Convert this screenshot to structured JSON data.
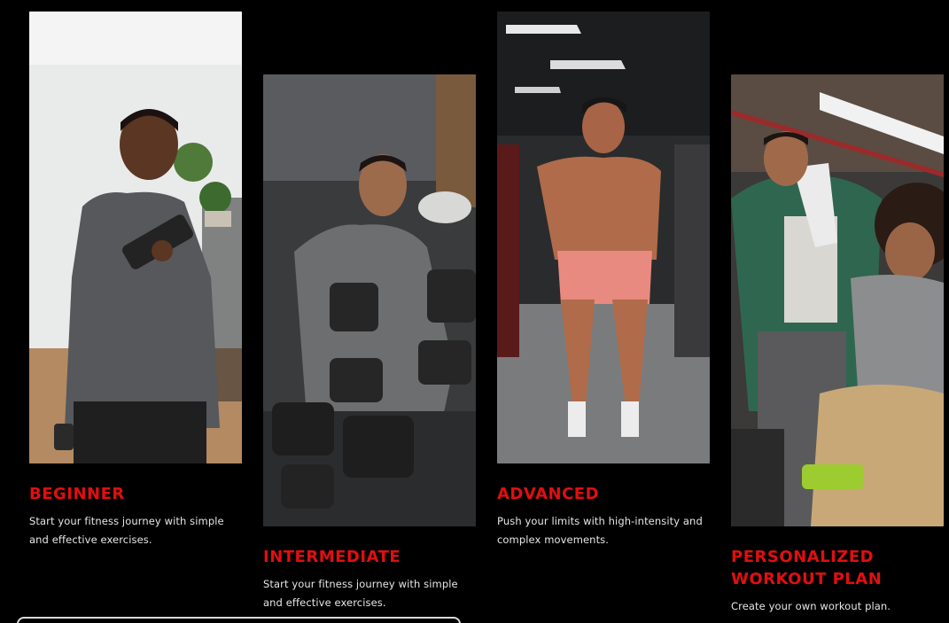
{
  "levels": [
    {
      "title": "BEGINNER",
      "description": "Start your fitness journey with simple and effective exercises."
    },
    {
      "title": "INTERMEDIATE",
      "description": "Start your fitness journey with simple and effective exercises."
    },
    {
      "title": "ADVANCED",
      "description": "Push your limits with high-intensity and complex movements."
    },
    {
      "title": "PERSONALIZED WORKOUT PLAN",
      "description": "Create your own workout plan."
    }
  ],
  "colors": {
    "background": "#000000",
    "accent": "#e10f0f",
    "text": "#e6e6e6"
  }
}
